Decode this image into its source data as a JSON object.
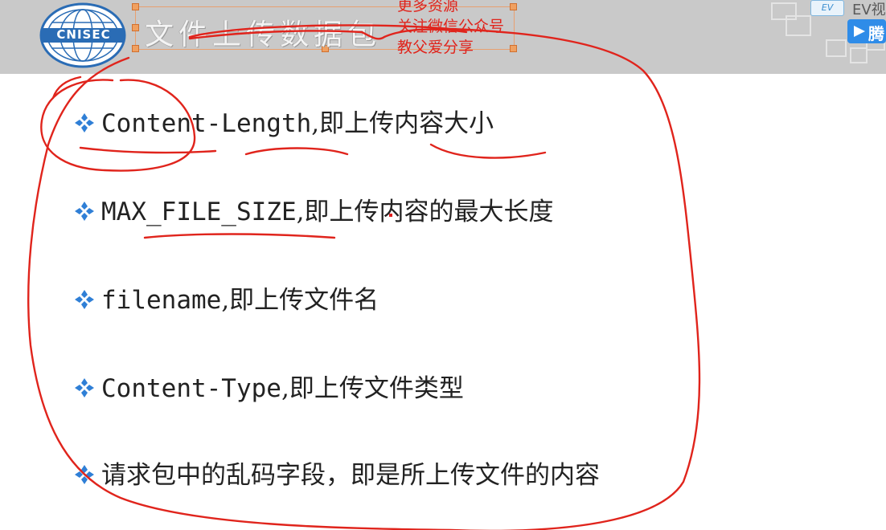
{
  "slide": {
    "title": "文件上传数据包",
    "logo_text": "CNISEC",
    "overlay_lines": [
      "更多资源",
      "关注微信公众号",
      "教父爱分享"
    ],
    "corner": {
      "badge": "EV",
      "text": "EV视",
      "play_text": "腾"
    },
    "bullets": [
      {
        "code": "Content-Length",
        "desc": ",即上传内容大小"
      },
      {
        "code": "MAX_FILE_SIZE",
        "desc": ",即上传内容的最大长度"
      },
      {
        "code": "filename",
        "desc": ",即上传文件名"
      },
      {
        "code": "Content-Type",
        "desc": ",即上传文件类型"
      },
      {
        "code": "",
        "desc": "请求包中的乱码字段，即是所上传文件的内容"
      }
    ]
  },
  "colors": {
    "header_bg": "#c9c9c9",
    "annotation_red": "#e0241c",
    "bullet_blue": "#2f7fd6",
    "logo_blue": "#2a6cb5"
  }
}
